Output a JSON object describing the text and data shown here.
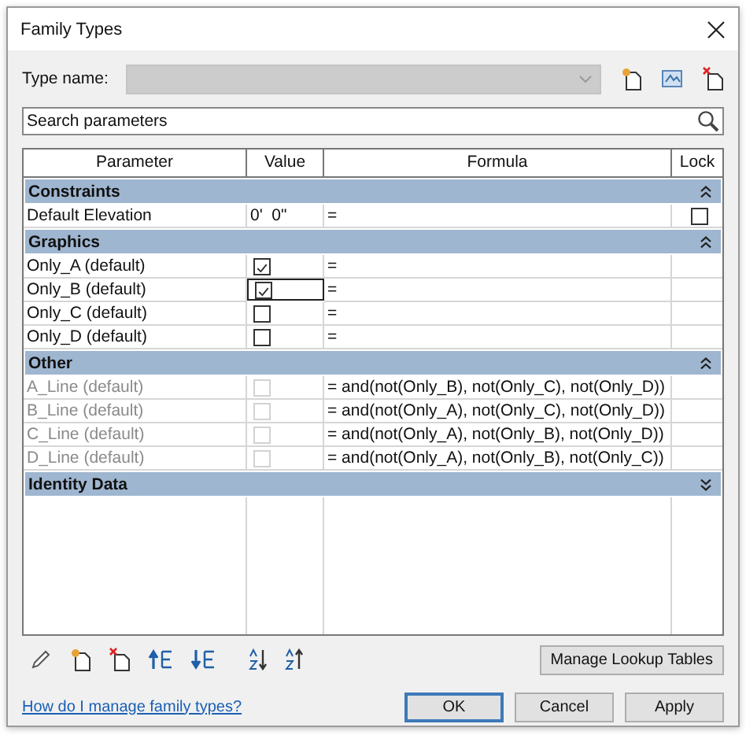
{
  "window": {
    "title": "Family Types"
  },
  "type_name": {
    "label": "Type name:",
    "disabled": true
  },
  "search": {
    "placeholder": "Search parameters"
  },
  "columns": [
    "Parameter",
    "Value",
    "Formula",
    "Lock"
  ],
  "groups": [
    {
      "name": "Constraints",
      "expanded": true,
      "rows": [
        {
          "kind": "text",
          "name": "Default Elevation",
          "value": "0'  0\"",
          "formula": "=",
          "disabled": false,
          "selected": false,
          "lock": {
            "checked": false
          }
        }
      ]
    },
    {
      "name": "Graphics",
      "expanded": true,
      "rows": [
        {
          "kind": "checkbox",
          "name": "Only_A (default)",
          "checked": true,
          "formula": "=",
          "disabled": false,
          "selected": false
        },
        {
          "kind": "checkbox",
          "name": "Only_B (default)",
          "checked": true,
          "formula": "=",
          "disabled": false,
          "selected": true
        },
        {
          "kind": "checkbox",
          "name": "Only_C (default)",
          "checked": false,
          "formula": "=",
          "disabled": false,
          "selected": false
        },
        {
          "kind": "checkbox",
          "name": "Only_D (default)",
          "checked": false,
          "formula": "=",
          "disabled": false,
          "selected": false
        }
      ]
    },
    {
      "name": "Other",
      "expanded": true,
      "rows": [
        {
          "kind": "checkbox",
          "name": "A_Line (default)",
          "checked": false,
          "formula": "= and(not(Only_B), not(Only_C), not(Only_D))",
          "disabled": true,
          "selected": false
        },
        {
          "kind": "checkbox",
          "name": "B_Line (default)",
          "checked": false,
          "formula": "= and(not(Only_A), not(Only_C), not(Only_D))",
          "disabled": true,
          "selected": false
        },
        {
          "kind": "checkbox",
          "name": "C_Line (default)",
          "checked": false,
          "formula": "= and(not(Only_A), not(Only_B), not(Only_D))",
          "disabled": true,
          "selected": false
        },
        {
          "kind": "checkbox",
          "name": "D_Line (default)",
          "checked": false,
          "formula": "= and(not(Only_A), not(Only_B), not(Only_C))",
          "disabled": true,
          "selected": false
        }
      ]
    },
    {
      "name": "Identity Data",
      "expanded": false
    }
  ],
  "lookup_button": "Manage Lookup Tables",
  "help_link": "How do I manage family types?",
  "buttons": [
    {
      "label": "OK",
      "default": true
    },
    {
      "label": "Cancel",
      "default": false
    },
    {
      "label": "Apply",
      "default": false
    }
  ]
}
